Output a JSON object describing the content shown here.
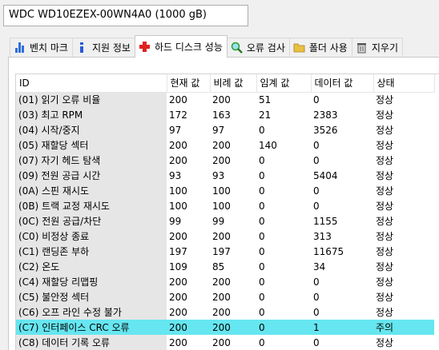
{
  "drive": {
    "selected": "WDC WD10EZEX-00WN4A0 (1000 gB)"
  },
  "tabs": [
    {
      "label": "벤치 마크",
      "icon": "benchmark-icon",
      "color": "#2e6fdb"
    },
    {
      "label": "지원 정보",
      "icon": "info-icon",
      "color": "#2a5bd7"
    },
    {
      "label": "하드 디스크 성능",
      "icon": "health-cross-icon",
      "color": "#e02020"
    },
    {
      "label": "오류 검사",
      "icon": "magnifier-icon",
      "color": "#2a9d2a"
    },
    {
      "label": "폴더 사용",
      "icon": "folder-icon",
      "color": "#e8c040"
    },
    {
      "label": "지우기",
      "icon": "trash-icon",
      "color": "#555555"
    }
  ],
  "active_tab_index": 2,
  "columns": [
    "ID",
    "현재 값",
    "비례 값",
    "임계 값",
    "데이터 값",
    "상태"
  ],
  "rows": [
    [
      "(01) 읽기 오류 비율",
      "200",
      "200",
      "51",
      "0",
      "정상"
    ],
    [
      "(03) 최고 RPM",
      "172",
      "163",
      "21",
      "2383",
      "정상"
    ],
    [
      "(04) 시작/중지",
      "97",
      "97",
      "0",
      "3526",
      "정상"
    ],
    [
      "(05) 재할당 섹터",
      "200",
      "200",
      "140",
      "0",
      "정상"
    ],
    [
      "(07) 자기 헤드 탐색",
      "200",
      "200",
      "0",
      "0",
      "정상"
    ],
    [
      "(09) 전원 공급 시간",
      "93",
      "93",
      "0",
      "5404",
      "정상"
    ],
    [
      "(0A) 스핀 재시도",
      "100",
      "100",
      "0",
      "0",
      "정상"
    ],
    [
      "(0B) 트랙 교정 재시도",
      "100",
      "100",
      "0",
      "0",
      "정상"
    ],
    [
      "(0C) 전원 공급/차단",
      "99",
      "99",
      "0",
      "1155",
      "정상"
    ],
    [
      "(C0) 비정상 종료",
      "200",
      "200",
      "0",
      "313",
      "정상"
    ],
    [
      "(C1) 랜딩존 부하",
      "197",
      "197",
      "0",
      "11675",
      "정상"
    ],
    [
      "(C2) 온도",
      "109",
      "85",
      "0",
      "34",
      "정상"
    ],
    [
      "(C4) 재할당 리맵핑",
      "200",
      "200",
      "0",
      "0",
      "정상"
    ],
    [
      "(C5) 불안정 섹터",
      "200",
      "200",
      "0",
      "0",
      "정상"
    ],
    [
      "(C6) 오프 라인 수정 불가",
      "200",
      "200",
      "0",
      "0",
      "정상"
    ],
    [
      "(C7) 인터페이스 CRC 오류",
      "200",
      "200",
      "0",
      "1",
      "주의"
    ],
    [
      "(C8) 데이터 기록 오류",
      "200",
      "200",
      "0",
      "0",
      "정상"
    ]
  ],
  "highlight_row_index": 15,
  "colors": {
    "highlight": "#66e6f0",
    "id_column_bg": "#e6e6e6"
  }
}
